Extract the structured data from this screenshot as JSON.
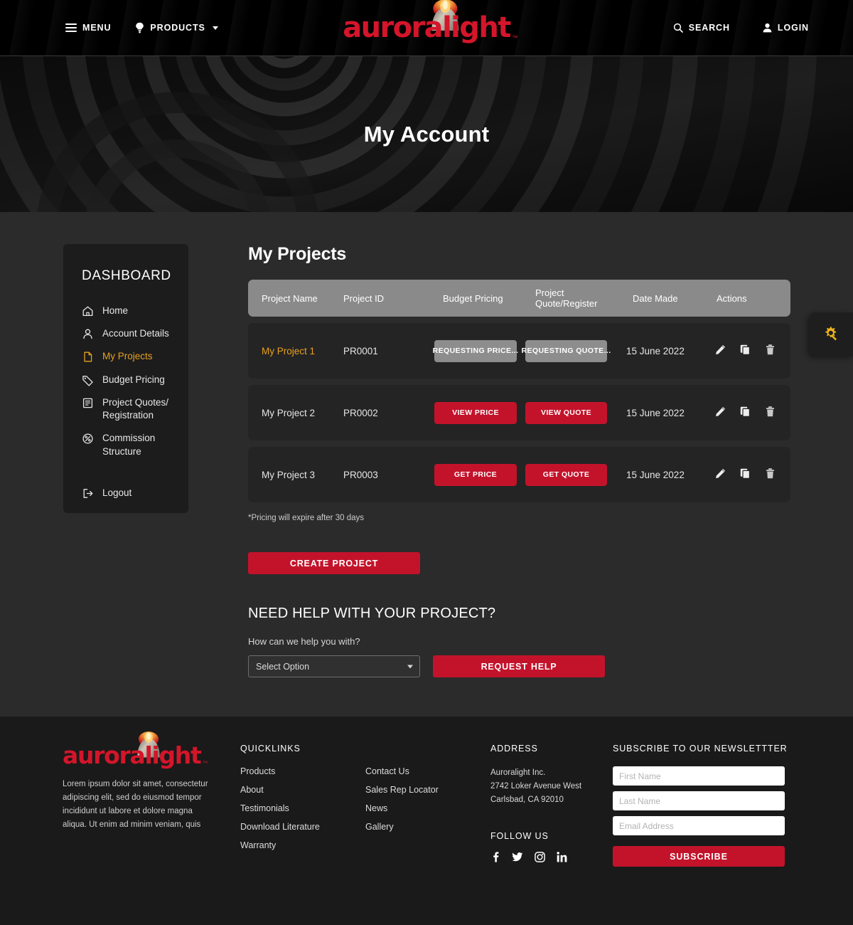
{
  "header": {
    "menu_label": "MENU",
    "products_label": "PRODUCTS",
    "search_label": "SEARCH",
    "login_label": "LOGIN",
    "logo_text": "auroralight",
    "logo_tm": "™"
  },
  "hero": {
    "title": "My Account"
  },
  "sidebar": {
    "title": "DASHBOARD",
    "items": [
      {
        "label": "Home",
        "icon": "home-icon",
        "active": false
      },
      {
        "label": "Account Details",
        "icon": "user-icon",
        "active": false
      },
      {
        "label": "My Projects",
        "icon": "file-icon",
        "active": true
      },
      {
        "label": "Budget Pricing",
        "icon": "tag-icon",
        "active": false
      },
      {
        "label": "Project Quotes/\nRegistration",
        "icon": "document-list-icon",
        "active": false
      },
      {
        "label": "Commission\nStructure",
        "icon": "percent-circle-icon",
        "active": false
      }
    ],
    "logout_label": "Logout"
  },
  "main": {
    "title": "My Projects",
    "columns": [
      "Project Name",
      "Project ID",
      "Budget Pricing",
      "Project Quote/Register",
      "Date Made",
      "Actions"
    ],
    "rows": [
      {
        "name": "My Project 1",
        "id": "PR0001",
        "price_label": "REQUESTING PRICE...",
        "price_state": "pending",
        "quote_label": "REQUESTING QUOTE...",
        "quote_state": "pending",
        "date": "15 June 2022"
      },
      {
        "name": "My Project 2",
        "id": "PR0002",
        "price_label": "VIEW PRICE",
        "price_state": "active",
        "quote_label": "VIEW QUOTE",
        "quote_state": "active",
        "date": "15 June 2022"
      },
      {
        "name": "My Project 3",
        "id": "PR0003",
        "price_label": "GET PRICE",
        "price_state": "active",
        "quote_label": "GET QUOTE",
        "quote_state": "active",
        "date": "15 June 2022"
      }
    ],
    "fineprint": "*Pricing will expire after 30 days",
    "create_project_label": "CREATE PROJECT",
    "help_title": "NEED HELP WITH YOUR PROJECT?",
    "help_label": "How can we help you with?",
    "help_select_value": "Select Option",
    "request_help_label": "REQUEST HELP"
  },
  "float_tab": {
    "icon": "gear-wrench-icon",
    "color": "#f0b51c"
  },
  "footer": {
    "logo_text": "auroralight",
    "logo_tm": "™",
    "brand_copy": "Lorem ipsum dolor sit amet, consectetur adipiscing elit, sed do eiusmod tempor incididunt ut labore et dolore magna aliqua. Ut enim ad minim veniam, quis",
    "quicklinks_head": "QUICKLINKS",
    "quicklinks_a": [
      "Products",
      "About",
      "Testimonials",
      "Download Literature",
      "Warranty"
    ],
    "quicklinks_b": [
      "Contact Us",
      "Sales Rep Locator",
      "News",
      "Gallery"
    ],
    "address_head": "ADDRESS",
    "address_lines": [
      "Auroralight Inc.",
      "2742 Loker Avenue West",
      "Carlsbad, CA 92010"
    ],
    "follow_head": "FOLLOW US",
    "socials": [
      "facebook-icon",
      "twitter-icon",
      "instagram-icon",
      "linkedin-icon"
    ],
    "subscribe_head": "SUBSCRIBE TO OUR NEWSLETTTER",
    "first_name_placeholder": "First Name",
    "last_name_placeholder": "Last Name",
    "email_placeholder": "Email Address",
    "subscribe_label": "SUBSCRIBE"
  },
  "colors": {
    "brand_red": "#c3132b",
    "accent_amber": "#e8a020",
    "page_bg": "#2b2b2b",
    "panel_bg": "#1c1c1c",
    "row_bg": "#242424",
    "header_gray": "#8a8a8a",
    "footer_bg": "#1a1a1a"
  }
}
